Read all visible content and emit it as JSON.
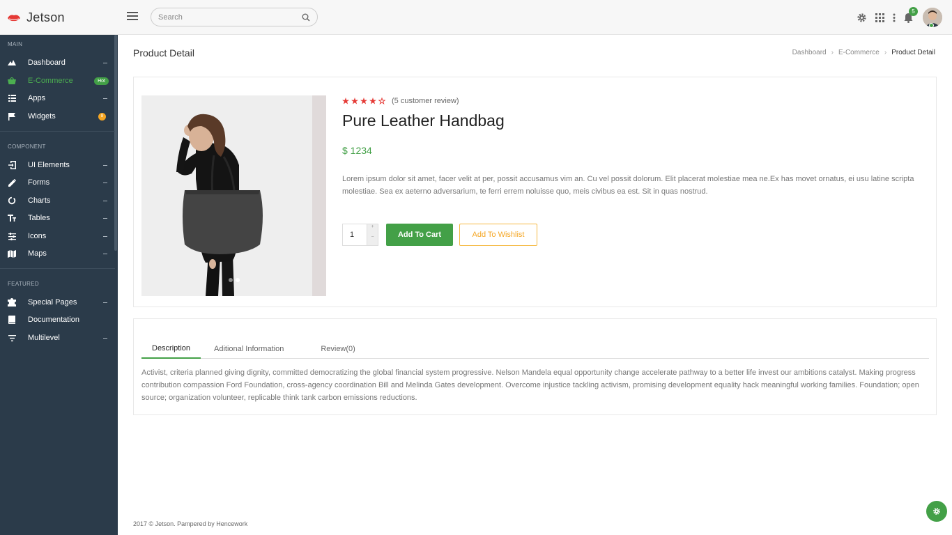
{
  "app": {
    "brand_name": "Jetson",
    "accent": "#43a047",
    "sidebar_bg": "#2b3b4a"
  },
  "header": {
    "search_placeholder": "Search",
    "notification_count": "5",
    "icons": [
      "menu-icon",
      "search-icon",
      "gear-icon",
      "apps-grid-icon",
      "more-vert-icon",
      "bell-icon"
    ]
  },
  "sidebar": {
    "sections": [
      {
        "title": "MAIN",
        "items": [
          {
            "label": "Dashboard",
            "icon": "mountain-icon"
          },
          {
            "label": "E-Commerce",
            "icon": "basket-icon",
            "badge": "Hot",
            "active": true
          },
          {
            "label": "Apps",
            "icon": "apps-icon"
          },
          {
            "label": "Widgets",
            "icon": "flag-icon",
            "badge": "8"
          }
        ]
      },
      {
        "title": "COMPONENT",
        "items": [
          {
            "label": "UI Elements",
            "icon": "login-icon"
          },
          {
            "label": "Forms",
            "icon": "pencil-icon"
          },
          {
            "label": "Charts",
            "icon": "chart-ring-icon"
          },
          {
            "label": "Tables",
            "icon": "text-height-icon"
          },
          {
            "label": "Icons",
            "icon": "sliders-icon"
          },
          {
            "label": "Maps",
            "icon": "map-icon"
          }
        ]
      },
      {
        "title": "FEATURED",
        "items": [
          {
            "label": "Special Pages",
            "icon": "puzzle-icon"
          },
          {
            "label": "Documentation",
            "icon": "book-icon"
          },
          {
            "label": "Multilevel",
            "icon": "filter-list-icon"
          }
        ]
      }
    ]
  },
  "page": {
    "title": "Product Detail",
    "breadcrumb": [
      "Dashboard",
      "E-Commerce",
      "Product Detail"
    ]
  },
  "product": {
    "rating": 4,
    "rating_max": 5,
    "review_text": "(5 customer review)",
    "name": "Pure Leather Handbag",
    "price": "$ 1234",
    "description": "Lorem ipsum dolor sit amet, facer velit at per, possit accusamus vim an. Cu vel possit dolorum. Elit placerat molestiae mea ne.Ex has movet ornatus, ei usu latine scripta molestiae. Sea ex aeterno adversarium, te ferri errem noluisse quo, meis civibus ea est. Sit in quas nostrud.",
    "quantity": "1",
    "add_to_cart": "Add To Cart",
    "add_to_wishlist": "Add To Wishlist",
    "carousel_slides": 2,
    "carousel_active": 1
  },
  "tabs": {
    "items": [
      "Description",
      "Aditional Information",
      "Review(0)"
    ],
    "active": "Description",
    "content": "Activist, criteria planned giving dignity, committed democratizing the global financial system progressive. Nelson Mandela equal opportunity change accelerate pathway to a better life invest our ambitions catalyst. Making progress contribution compassion Ford Foundation, cross-agency coordination Bill and Melinda Gates development. Overcome injustice tackling activism, promising development equality hack meaningful working families. Foundation; open source; organization volunteer, replicable think tank carbon emissions reductions."
  },
  "footer": {
    "text": "2017 © Jetson. Pampered by Hencework"
  }
}
